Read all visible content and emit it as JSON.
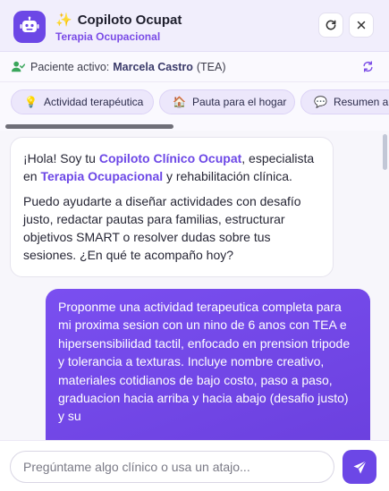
{
  "header": {
    "app_title": "Copiloto Ocupat",
    "subtitle": "Terapia Ocupacional",
    "icons": {
      "logo": "robot-icon",
      "title": "sparkles-icon",
      "refresh": "refresh-icon",
      "close": "close-icon"
    },
    "accent_color": "#6c47e6"
  },
  "patient_bar": {
    "label": "Paciente activo:",
    "name": "Marcela Castro",
    "tag": "(TEA)",
    "icons": {
      "user": "user-check-icon",
      "sync": "sync-icon"
    }
  },
  "quick_actions": [
    {
      "icon": "lightbulb-icon",
      "label": "Actividad terapéutica"
    },
    {
      "icon": "house-icon",
      "label": "Pauta para el hogar"
    },
    {
      "icon": "speech-bubble-icon",
      "label": "Resumen ap"
    }
  ],
  "messages": {
    "bot": {
      "p1_a": "¡Hola! Soy tu ",
      "p1_b": "Copiloto Clínico Ocupat",
      "p1_c": ", especialista en ",
      "p1_d": "Terapia Ocupacional",
      "p1_e": " y rehabilitación clínica.",
      "p2": "Puedo ayudarte a diseñar actividades con desafío justo, redactar pautas para familias, estructurar objetivos SMART o resolver dudas sobre tus sesiones. ¿En qué te acompaño hoy?"
    },
    "user": {
      "text": "Proponme una actividad terapeutica completa para mi proxima sesion con un nino de 6 anos con TEA e hipersensibilidad tactil, enfocado en prension tripode y tolerancia a texturas. Incluye nombre creativo,\nmateriales cotidianos de bajo costo, paso a paso, graduacion hacia arriba y hacia abajo (desafio justo) y su"
    }
  },
  "composer": {
    "placeholder": "Pregúntame algo clínico o usa un atajo...",
    "value": "",
    "send_icon": "paper-plane-icon"
  }
}
